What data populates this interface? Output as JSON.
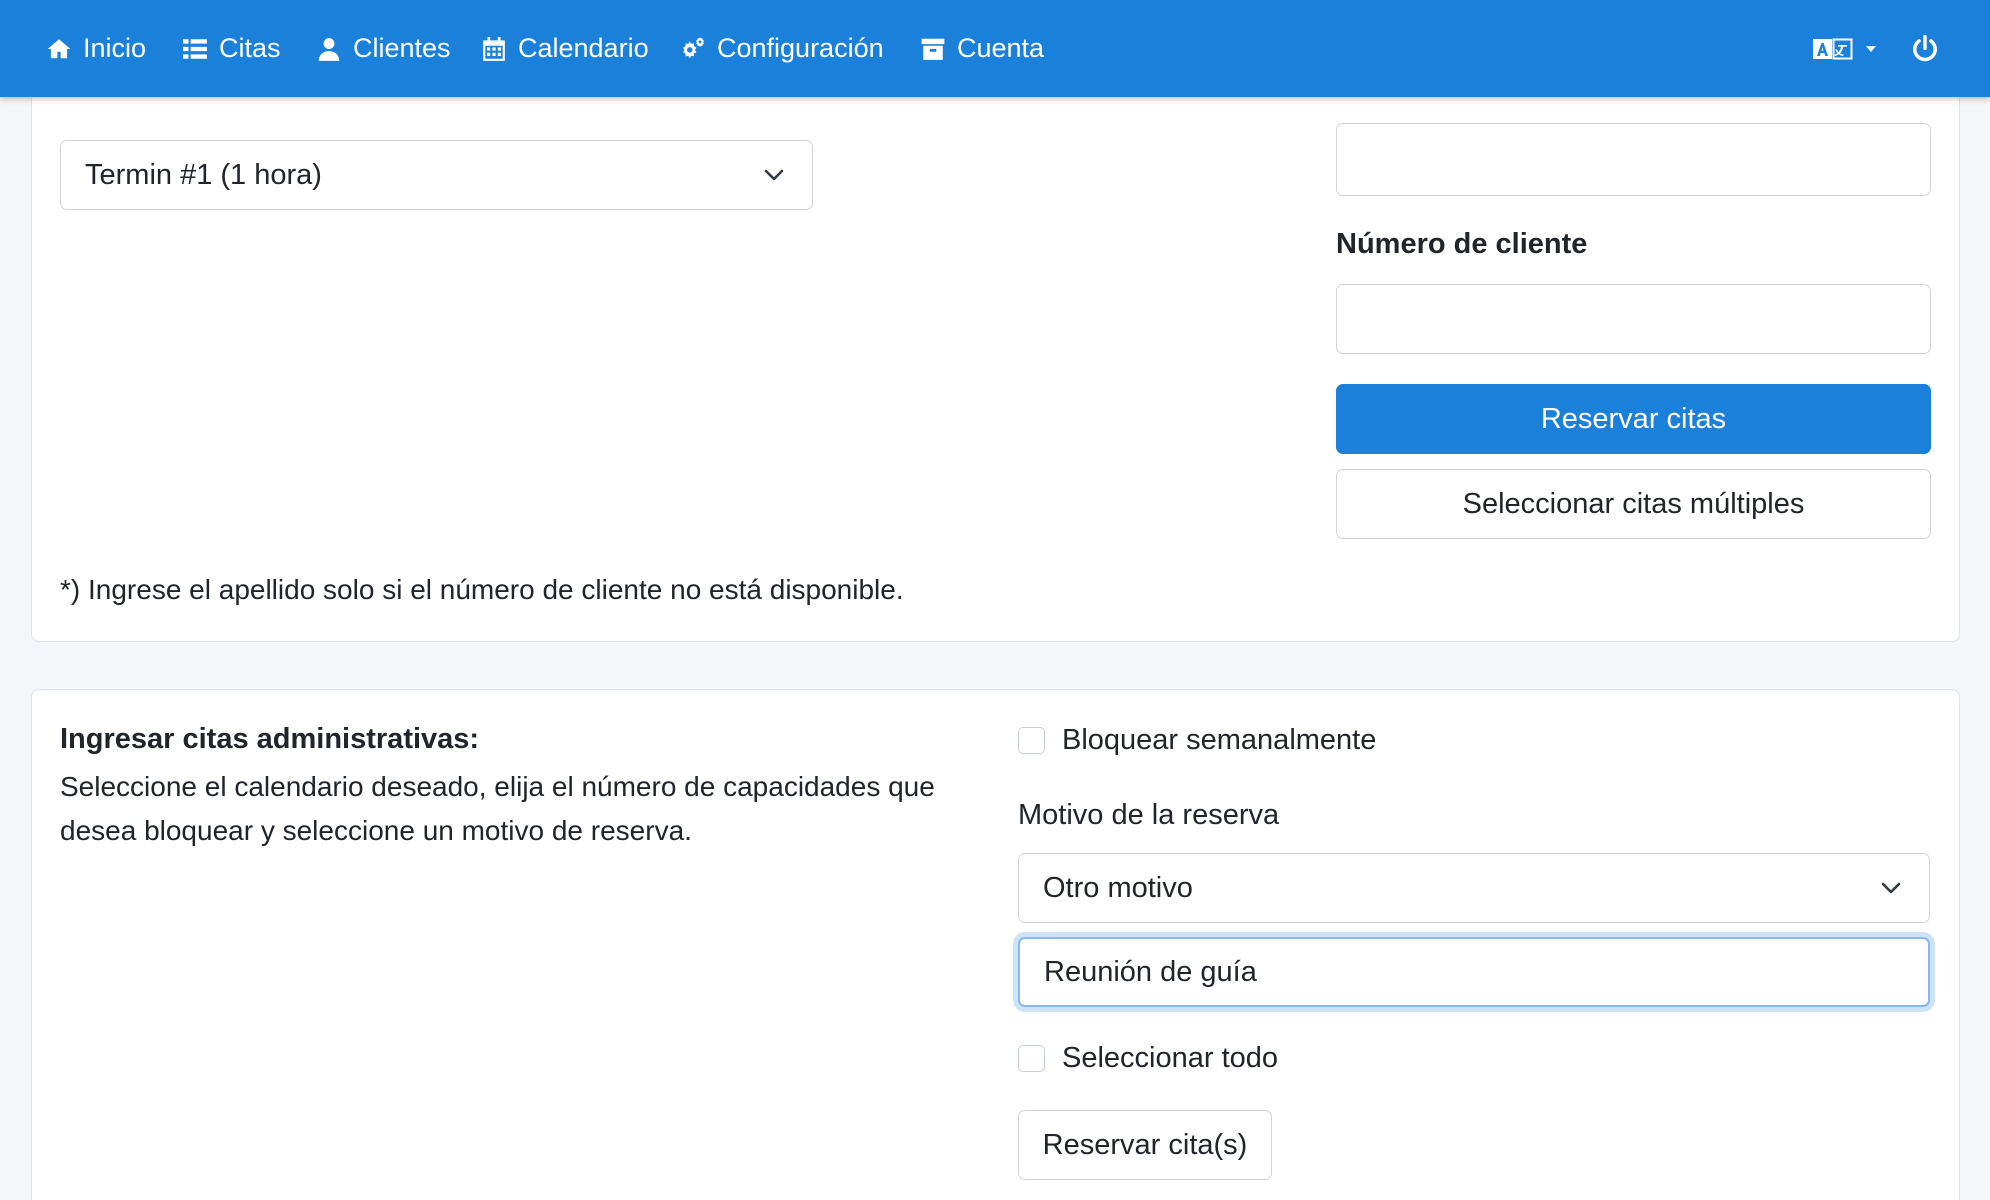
{
  "nav": {
    "items": [
      {
        "label": "Inicio",
        "icon": "home-icon"
      },
      {
        "label": "Citas",
        "icon": "list-icon"
      },
      {
        "label": "Clientes",
        "icon": "user-icon"
      },
      {
        "label": "Calendario",
        "icon": "calendar-icon"
      },
      {
        "label": "Configuración",
        "icon": "cogs-icon"
      },
      {
        "label": "Cuenta",
        "icon": "archive-icon"
      }
    ],
    "language_icon": "language-icon",
    "power_icon": "power-icon",
    "color": "#1b80d9"
  },
  "booking": {
    "appointment_select": "Termin #1 (1 hora)",
    "lastname_value": "",
    "customer_number_label": "Número de cliente",
    "customer_number_value": "",
    "reserve_button": "Reservar citas",
    "multi_select_button": "Seleccionar citas múltiples",
    "note": "*) Ingrese el apellido solo si el número de cliente no está disponible."
  },
  "admin": {
    "title": "Ingresar citas administrativas:",
    "description_line1": "Seleccione el calendario deseado, elija el número de capacidades que",
    "description_line2": "desea bloquear y seleccione un motivo de reserva.",
    "block_weekly_label": "Bloquear semanalmente",
    "reason_label": "Motivo de la reserva",
    "reason_select": "Otro motivo",
    "reason_text": "Reunión de guía",
    "select_all_label": "Seleccionar todo",
    "reserve_button": "Reservar cita(s)"
  }
}
